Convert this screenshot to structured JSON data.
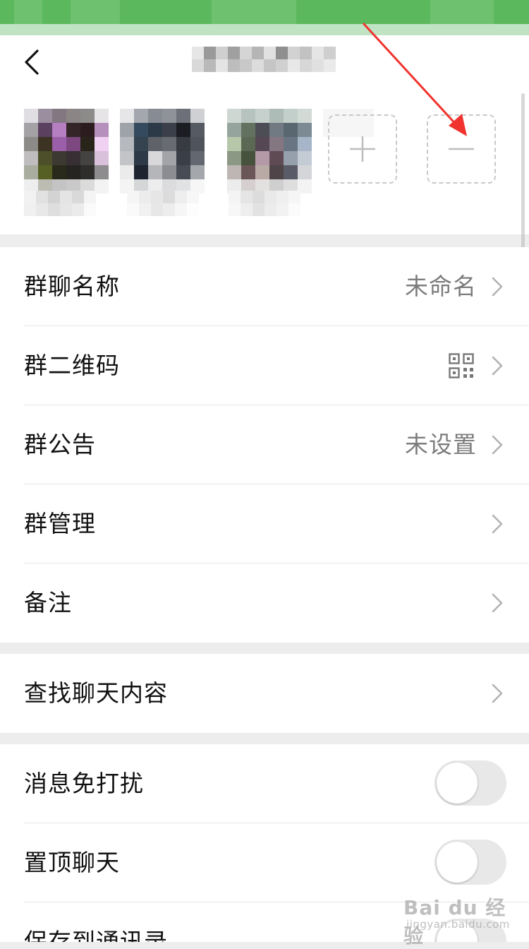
{
  "header": {
    "back_icon": "chevron-left-icon",
    "title_obscured": true
  },
  "members": {
    "add_icon": "plus-icon",
    "remove_icon": "minus-icon",
    "count_visible": 3
  },
  "settings": {
    "group_info": [
      {
        "key": "name",
        "label": "群聊名称",
        "value": "未命名"
      },
      {
        "key": "qrcode",
        "label": "群二维码",
        "value": "",
        "icon": "qr-code-icon"
      },
      {
        "key": "announcement",
        "label": "群公告",
        "value": "未设置"
      },
      {
        "key": "manage",
        "label": "群管理",
        "value": ""
      },
      {
        "key": "remark",
        "label": "备注",
        "value": ""
      }
    ],
    "search": [
      {
        "key": "search_chat",
        "label": "查找聊天内容"
      }
    ],
    "toggles": [
      {
        "key": "mute",
        "label": "消息免打扰",
        "on": false
      },
      {
        "key": "sticky",
        "label": "置顶聊天",
        "on": false
      },
      {
        "key": "save_contacts",
        "label": "保存到通讯录",
        "on": false
      }
    ]
  },
  "colors": {
    "status_bar": "#5cb85c",
    "annotation_arrow": "#f0332d",
    "toggle_off": "#e8e8e8"
  },
  "watermark": {
    "main": "Bai du 经验",
    "sub": "jingyan.baidu.com"
  }
}
